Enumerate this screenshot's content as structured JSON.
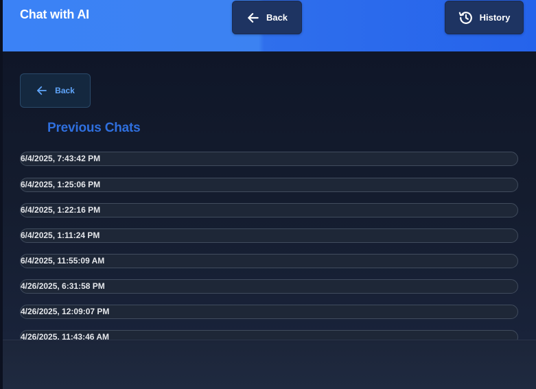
{
  "header": {
    "title": "Chat with AI",
    "back_label": "Back",
    "history_label": "History"
  },
  "main": {
    "back_label": "Back",
    "section_title": "Previous Chats",
    "chats": [
      "6/4/2025, 7:43:42 PM",
      "6/4/2025, 1:25:06 PM",
      "6/4/2025, 1:22:16 PM",
      "6/4/2025, 1:11:24 PM",
      "6/4/2025, 11:55:09 AM",
      "4/26/2025, 6:31:58 PM",
      "4/26/2025, 12:09:07 PM",
      "4/26/2025, 11:43:46 AM"
    ]
  },
  "icons": {
    "back": "arrow-left-icon",
    "history": "history-icon"
  },
  "colors": {
    "header_blue": "#3b82f6",
    "accent_title": "#2f6fde",
    "background": "#141b2b"
  }
}
